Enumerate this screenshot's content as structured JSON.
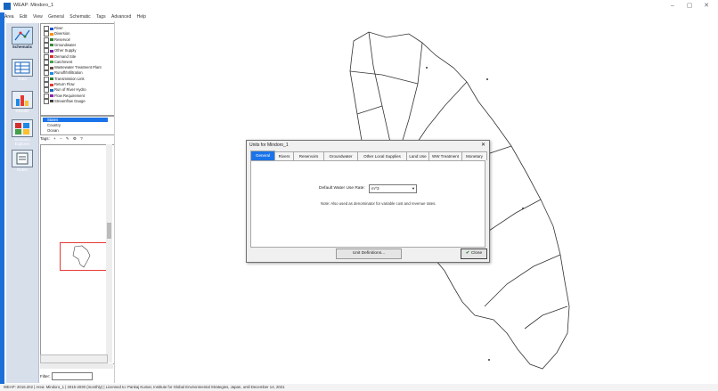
{
  "window": {
    "title": "WEAP: Mindoro_1",
    "minimize": "–",
    "maximize": "▢",
    "close": "✕"
  },
  "menu": [
    "Area",
    "Edit",
    "View",
    "General",
    "Schematic",
    "Tags",
    "Advanced",
    "Help"
  ],
  "view_bar": [
    {
      "label": "Schematic",
      "icon": "schematic-icon"
    },
    {
      "label": "Data",
      "icon": "data-icon"
    },
    {
      "label": "Results",
      "icon": "results-icon"
    },
    {
      "label": "Scenario Explorer",
      "icon": "scenario-explorer-icon"
    },
    {
      "label": "Notes",
      "icon": "notes-icon"
    }
  ],
  "legend_items": [
    {
      "label": "River",
      "color": "#1e4fd6"
    },
    {
      "label": "Diversion",
      "color": "#ff8f00"
    },
    {
      "label": "Reservoir",
      "color": "#2e7d32"
    },
    {
      "label": "Groundwater",
      "color": "#388e3c"
    },
    {
      "label": "Other Supply",
      "color": "#7b1fa2"
    },
    {
      "label": "Demand Site",
      "color": "#d32f2f"
    },
    {
      "label": "Catchment",
      "color": "#43a047"
    },
    {
      "label": "Wastewater Treatment Plant",
      "color": "#6d4c41"
    },
    {
      "label": "Runoff/Infiltration",
      "color": "#1e88e5"
    },
    {
      "label": "Transmission Link",
      "color": "#2e7d32"
    },
    {
      "label": "Return Flow",
      "color": "#e53935"
    },
    {
      "label": "Run of River Hydro",
      "color": "#1565c0"
    },
    {
      "label": "Flow Requirement",
      "color": "#8e24aa"
    },
    {
      "label": "Streamflow Gauge",
      "color": "#424242"
    }
  ],
  "layers": [
    "States",
    "Country",
    "Ocean"
  ],
  "tags_label": "Tags:",
  "filter_label": "Filter:",
  "status_text": "WEAP: 2016.202  |  Area: Mindoro_1  |  2015-2030 (monthly)  |  Licensed to: Pankaj Kumar, Institute for Global Environmental Strategies, Japan, until December 14, 2021",
  "dialog": {
    "title": "Units for Mindoro_1",
    "close": "✕",
    "tabs": [
      "General",
      "Rivers",
      "Reservoirs",
      "Groundwater",
      "Other Local Supplies",
      "Land Use",
      "WW Treatment",
      "Monetary"
    ],
    "active_tab": "General",
    "rate_label": "Default Water Use Rate:",
    "rate_value": "m^3",
    "rate_note": "Note: Also used as denominator for variable cost and revenue rates.",
    "unit_definitions_button": "Unit Definitions...",
    "close_button": "Close"
  }
}
